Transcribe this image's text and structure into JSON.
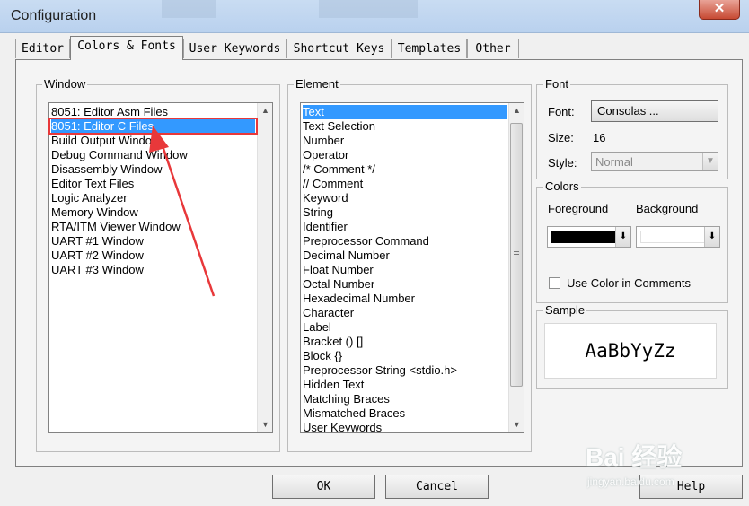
{
  "window": {
    "title": "Configuration",
    "close_glyph": "✕"
  },
  "tabs": [
    {
      "label": "Editor",
      "active": false
    },
    {
      "label": "Colors & Fonts",
      "active": true
    },
    {
      "label": "User Keywords",
      "active": false
    },
    {
      "label": "Shortcut Keys",
      "active": false
    },
    {
      "label": "Templates",
      "active": false
    },
    {
      "label": "Other",
      "active": false
    }
  ],
  "window_group": {
    "label": "Window",
    "items": [
      "8051: Editor Asm Files",
      "8051: Editor C Files",
      "Build Output Window",
      "Debug Command Window",
      "Disassembly Window",
      "Editor Text Files",
      "Logic Analyzer",
      "Memory Window",
      "RTA/ITM Viewer Window",
      "UART #1 Window",
      "UART #2 Window",
      "UART #3 Window"
    ],
    "selected_index": 1
  },
  "element_group": {
    "label": "Element",
    "items": [
      "Text",
      "Text Selection",
      "Number",
      "Operator",
      "/* Comment */",
      "// Comment",
      "Keyword",
      "String",
      "Identifier",
      "Preprocessor Command",
      "Decimal Number",
      "Float Number",
      "Octal Number",
      "Hexadecimal Number",
      "Character",
      "Label",
      "Bracket () []",
      "Block {}",
      "Preprocessor String <stdio.h>",
      "Hidden Text",
      "Matching Braces",
      "Mismatched Braces",
      "User Keywords"
    ],
    "selected_index": 0
  },
  "font_group": {
    "label": "Font",
    "font_label": "Font:",
    "font_button": "Consolas ...",
    "size_label": "Size:",
    "size_value": "16",
    "style_label": "Style:",
    "style_value": "Normal"
  },
  "colors_group": {
    "label": "Colors",
    "foreground_label": "Foreground",
    "background_label": "Background",
    "foreground_color": "#000000",
    "background_color": "#ffffff",
    "use_color_in_comments": "Use Color in Comments",
    "use_color_checked": false
  },
  "sample_group": {
    "label": "Sample",
    "sample_text": "AaBbYyZz"
  },
  "buttons": {
    "ok": "OK",
    "cancel": "Cancel",
    "help": "Help"
  },
  "watermark": {
    "text": "Bai 经验",
    "sub": "jingyan.baidu.com"
  },
  "colors": {
    "selection": "#3399ff",
    "highlight_box": "#e8383a"
  }
}
